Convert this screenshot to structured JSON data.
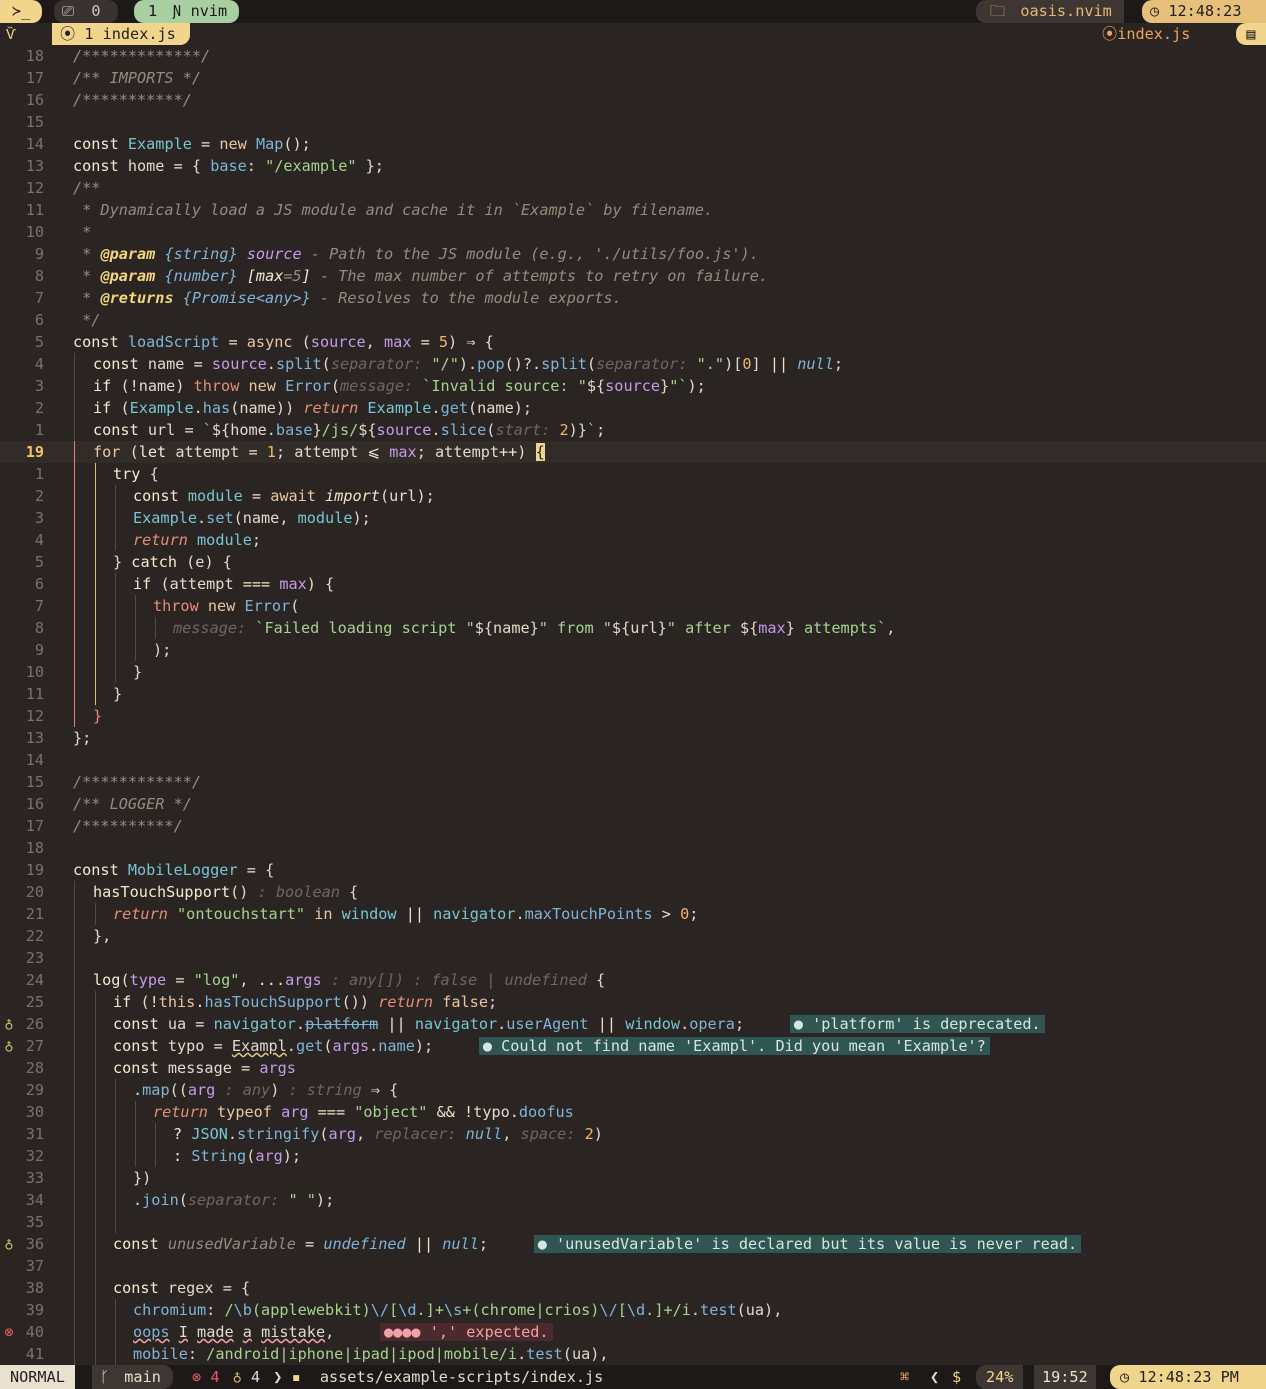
{
  "tmux": {
    "prompt_glyph": "≻_",
    "session_count": "0",
    "window_index": "1",
    "window_name": "nvim",
    "project": "oasis.nvim",
    "clock": "12:48:23"
  },
  "bufbar": {
    "buffer_tab": "1 index.js",
    "winbar_file": "index.js"
  },
  "colors": {
    "accent_yellow": "#f2d58c",
    "window_green": "#a8cfa1",
    "background": "#2a2523",
    "error": "#e45b65",
    "diag_bg": "#2f5652"
  },
  "editor": {
    "current_line": "19",
    "line_numbers": [
      "18",
      "17",
      "16",
      "15",
      "14",
      "13",
      "12",
      "11",
      "10",
      "9",
      "8",
      "7",
      "6",
      "5",
      "4",
      "3",
      "2",
      "1",
      "19",
      "1",
      "2",
      "3",
      "4",
      "5",
      "6",
      "7",
      "8",
      "9",
      "10",
      "11",
      "12",
      "13",
      "14",
      "15",
      "16",
      "17",
      "18",
      "19",
      "20",
      "21",
      "22",
      "23",
      "24",
      "25",
      "26",
      "27",
      "28",
      "29",
      "30",
      "31",
      "32",
      "33",
      "34",
      "35",
      "36",
      "37",
      "38",
      "39",
      "40",
      "41"
    ],
    "diagnostics": {
      "d26": "● 'platform' is deprecated.",
      "d27": "● Could not find name 'Exampl'. Did you mean 'Example'?",
      "d36": "● 'unusedVariable' is declared but its value is never read.",
      "d40": "●●●● ',' expected."
    }
  },
  "status": {
    "mode": "NORMAL",
    "branch": "main",
    "errors": "4",
    "hints": "4",
    "path": "assets/example-scripts/index.js",
    "shell": "$",
    "percent": "24%",
    "position": "19:52",
    "clock": "12:48:23 PM"
  }
}
